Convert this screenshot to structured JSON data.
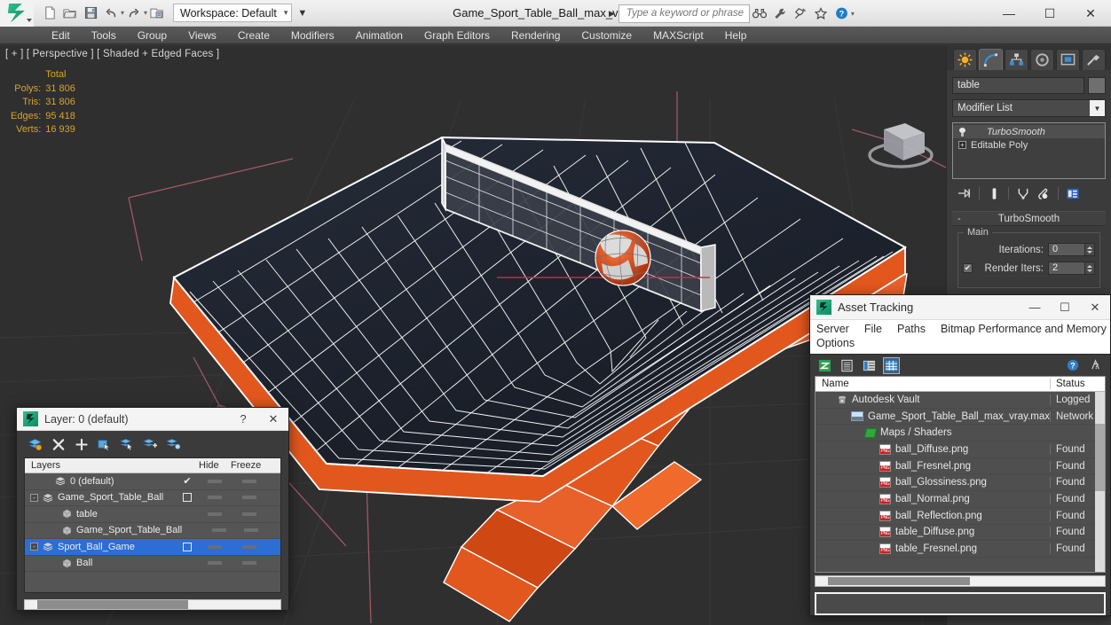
{
  "app": {
    "document_title": "Game_Sport_Table_Ball_max_vray.max",
    "workspace": "Workspace: Default",
    "search_placeholder": "Type a keyword or phrase"
  },
  "quick_access": [
    {
      "name": "new-file-icon",
      "label": "New"
    },
    {
      "name": "open-file-icon",
      "label": "Open"
    },
    {
      "name": "save-file-icon",
      "label": "Save"
    },
    {
      "name": "undo-icon",
      "label": "Undo"
    },
    {
      "name": "redo-icon",
      "label": "Redo"
    },
    {
      "name": "project-folder-icon",
      "label": "Set Project Folder"
    }
  ],
  "title_tools": [
    {
      "name": "binoculars-icon",
      "label": "Search"
    },
    {
      "name": "wrench-icon",
      "label": "Tools"
    },
    {
      "name": "satellite-icon",
      "label": "Communication Center"
    },
    {
      "name": "star-icon",
      "label": "Favorites"
    },
    {
      "name": "help-icon",
      "label": "Help"
    }
  ],
  "window_controls": {
    "minimize": "—",
    "maximize": "☐",
    "close": "✕"
  },
  "menu": {
    "items": [
      "Edit",
      "Tools",
      "Group",
      "Views",
      "Create",
      "Modifiers",
      "Animation",
      "Graph Editors",
      "Rendering",
      "Customize",
      "MAXScript",
      "Help"
    ]
  },
  "viewport": {
    "label": "[ + ] [ Perspective ] [ Shaded + Edged Faces ]",
    "stats": {
      "header": "Total",
      "rows": [
        {
          "label": "Polys:",
          "value": "31 806"
        },
        {
          "label": "Tris:",
          "value": "31 806"
        },
        {
          "label": "Edges:",
          "value": "95 418"
        },
        {
          "label": "Verts:",
          "value": "16 939"
        }
      ]
    },
    "colors": {
      "background": "#2f2f2f",
      "wireframe": "#ffffff",
      "table_top": "#1b2130",
      "table_legs": "#e2571e",
      "ball_orange": "#e24a18",
      "ball_white": "#d8d8d8",
      "grid_line": "#8d4a58",
      "stats_text": "#d9a32b"
    }
  },
  "command_panel": {
    "tabs": [
      {
        "name": "create-tab",
        "icon": "sun-icon",
        "active": false
      },
      {
        "name": "modify-tab",
        "icon": "curve-icon",
        "active": true
      },
      {
        "name": "hierarchy-tab",
        "icon": "hierarchy-icon",
        "active": false
      },
      {
        "name": "motion-tab",
        "icon": "wheel-icon",
        "active": false
      },
      {
        "name": "display-tab",
        "icon": "display-icon",
        "active": false
      },
      {
        "name": "utilities-tab",
        "icon": "hammer-icon",
        "active": false
      }
    ],
    "object_name": "table",
    "modifier_list_label": "Modifier List",
    "modifier_stack": [
      {
        "name": "TurboSmooth",
        "italic": true,
        "icon": "lightbulb-icon"
      },
      {
        "name": "Editable Poly",
        "italic": false,
        "icon": "plus-box-icon"
      }
    ],
    "stack_tools": [
      {
        "name": "pin-stack-icon"
      },
      {
        "name": "show-end-result-icon"
      },
      {
        "name": "make-unique-icon"
      },
      {
        "name": "remove-modifier-icon"
      },
      {
        "name": "configure-modifier-sets-icon"
      }
    ],
    "rollout": {
      "title": "TurboSmooth",
      "collapse_glyph": "-",
      "group_title": "Main",
      "fields": [
        {
          "label": "Iterations:",
          "value": "0",
          "checkbox": false,
          "checked": false
        },
        {
          "label": "Render Iters:",
          "value": "2",
          "checkbox": true,
          "checked": true
        }
      ]
    }
  },
  "layer_dialog": {
    "title": "Layer: 0 (default)",
    "help_glyph": "?",
    "close_glyph": "✕",
    "toolbar": [
      {
        "name": "new-layer-icon"
      },
      {
        "name": "delete-layer-icon",
        "glyph": "✕"
      },
      {
        "name": "add-layer-icon",
        "glyph": "+"
      },
      {
        "name": "select-objects-in-layer-icon"
      },
      {
        "name": "select-highlighted-layer-icon"
      },
      {
        "name": "add-selection-to-layer-icon"
      },
      {
        "name": "layer-settings-icon"
      }
    ],
    "columns": [
      "Layers",
      "",
      "Hide",
      "Freeze",
      ""
    ],
    "rows": [
      {
        "name": "0 (default)",
        "indent": 1,
        "expander": "",
        "type": "layer",
        "current": true,
        "hide": "dash",
        "freeze": "dash"
      },
      {
        "name": "Game_Sport_Table_Ball",
        "indent": 0,
        "expander": "-",
        "type": "layer",
        "current": false,
        "box": true,
        "hide": "dash",
        "freeze": "dash"
      },
      {
        "name": "table",
        "indent": 2,
        "expander": "",
        "type": "object",
        "hide": "dash",
        "freeze": "dash"
      },
      {
        "name": "Game_Sport_Table_Ball",
        "indent": 2,
        "expander": "",
        "type": "object",
        "hide": "dash",
        "freeze": "dash"
      },
      {
        "name": "Sport_Ball_Game",
        "indent": 0,
        "expander": "-",
        "type": "layer",
        "selected": true,
        "box": true,
        "hide": "dash",
        "freeze": "dash"
      },
      {
        "name": "Ball",
        "indent": 2,
        "expander": "",
        "type": "object",
        "hide": "dash",
        "freeze": "dash"
      }
    ]
  },
  "asset_dialog": {
    "title": "Asset Tracking",
    "window_controls": {
      "minimize": "—",
      "maximize": "☐",
      "close": "✕"
    },
    "menu_line1": [
      "Server",
      "File",
      "Paths",
      "Bitmap Performance and Memory"
    ],
    "menu_line2": [
      "Options"
    ],
    "toolbar": [
      {
        "name": "refresh-icon",
        "active": false
      },
      {
        "name": "list-view-icon",
        "active": false
      },
      {
        "name": "detail-view-icon",
        "active": false
      },
      {
        "name": "grid-view-icon",
        "active": true
      }
    ],
    "toolbar_right": [
      {
        "name": "help-icon"
      },
      {
        "name": "context-help-icon"
      }
    ],
    "columns": [
      "Name",
      "Status"
    ],
    "rows": [
      {
        "name": "Autodesk Vault",
        "status": "Logged",
        "indent": 1,
        "icon": "vault-icon"
      },
      {
        "name": "Game_Sport_Table_Ball_max_vray.max",
        "status": "Network",
        "indent": 2,
        "icon": "max-file-icon"
      },
      {
        "name": "Maps / Shaders",
        "status": "",
        "indent": 3,
        "icon": "maps-shaders-icon"
      },
      {
        "name": "ball_Diffuse.png",
        "status": "Found",
        "indent": 4,
        "icon": "png-icon"
      },
      {
        "name": "ball_Fresnel.png",
        "status": "Found",
        "indent": 4,
        "icon": "png-icon"
      },
      {
        "name": "ball_Glossiness.png",
        "status": "Found",
        "indent": 4,
        "icon": "png-icon"
      },
      {
        "name": "ball_Normal.png",
        "status": "Found",
        "indent": 4,
        "icon": "png-icon"
      },
      {
        "name": "ball_Reflection.png",
        "status": "Found",
        "indent": 4,
        "icon": "png-icon"
      },
      {
        "name": "table_Diffuse.png",
        "status": "Found",
        "indent": 4,
        "icon": "png-icon"
      },
      {
        "name": "table_Fresnel.png",
        "status": "Found",
        "indent": 4,
        "icon": "png-icon"
      }
    ]
  }
}
